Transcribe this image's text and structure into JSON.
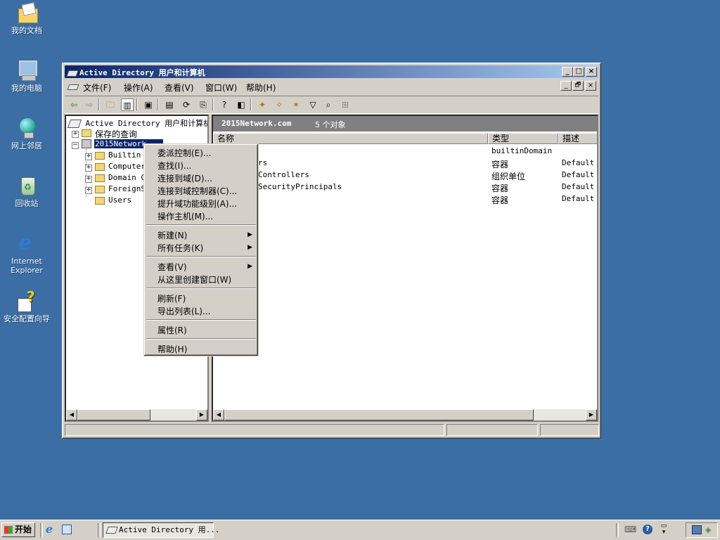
{
  "desktop": {
    "icons": [
      {
        "label": "我的文档"
      },
      {
        "label": "我的电脑"
      },
      {
        "label": "网上邻居"
      },
      {
        "label": "回收站"
      },
      {
        "label_line1": "Internet",
        "label_line2": "Explorer"
      },
      {
        "label": "安全配置向导"
      }
    ]
  },
  "window": {
    "title": "Active Directory 用户和计算机",
    "controls": {
      "minimize": "_",
      "maximize": "□",
      "close": "×",
      "child_restore": "🗗"
    },
    "menu": [
      "文件(F)",
      "操作(A)",
      "查看(V)",
      "窗口(W)",
      "帮助(H)"
    ],
    "toolbar_icons": [
      "back-icon",
      "forward-icon",
      "up-folder-icon",
      "show-hide-tree-icon",
      "cut-icon",
      "properties-icon",
      "refresh-icon",
      "export-icon",
      "help-icon",
      "console-tree-icon",
      "new-user-icon",
      "new-group-icon",
      "new-ou-icon",
      "filter-icon",
      "find-icon",
      "add-to-group-icon"
    ]
  },
  "tree": {
    "root": "Active Directory 用户和计算机",
    "saved_queries": "保存的查询",
    "domain": "2015Network",
    "children": [
      "Builtin",
      "Computer",
      "Domain C",
      "ForeignS",
      "Users"
    ]
  },
  "list": {
    "header_domain": "2015Network.com",
    "header_count": "5 个对象",
    "columns": [
      "名称",
      "类型",
      "描述"
    ],
    "rows": [
      {
        "name": "",
        "type": "builtinDomain",
        "desc": ""
      },
      {
        "name": "rs",
        "type": "容器",
        "desc": "Default c"
      },
      {
        "name": "Controllers",
        "type": "组织单位",
        "desc": "Default c"
      },
      {
        "name": "SecurityPrincipals",
        "type": "容器",
        "desc": "Default c"
      },
      {
        "name": "",
        "type": "容器",
        "desc": "Default c"
      }
    ]
  },
  "context_menu": {
    "group1": [
      "委派控制(E)...",
      "查找(I)...",
      "连接到域(D)...",
      "连接到域控制器(C)...",
      "提升域功能级别(A)...",
      "操作主机(M)..."
    ],
    "group2": [
      "新建(N)",
      "所有任务(K)"
    ],
    "group3": [
      "查看(V)",
      "从这里创建窗口(W)"
    ],
    "group4": [
      "刷新(F)",
      "导出列表(L)..."
    ],
    "group5": [
      "属性(R)"
    ],
    "group6": [
      "帮助(H)"
    ]
  },
  "taskbar": {
    "start": "开始",
    "task": "Active Directory 用..."
  },
  "colors": {
    "desktop": "#3a6ea5",
    "title_start": "#0a246a",
    "title_end": "#a6caf0",
    "selection": "#0a246a"
  }
}
